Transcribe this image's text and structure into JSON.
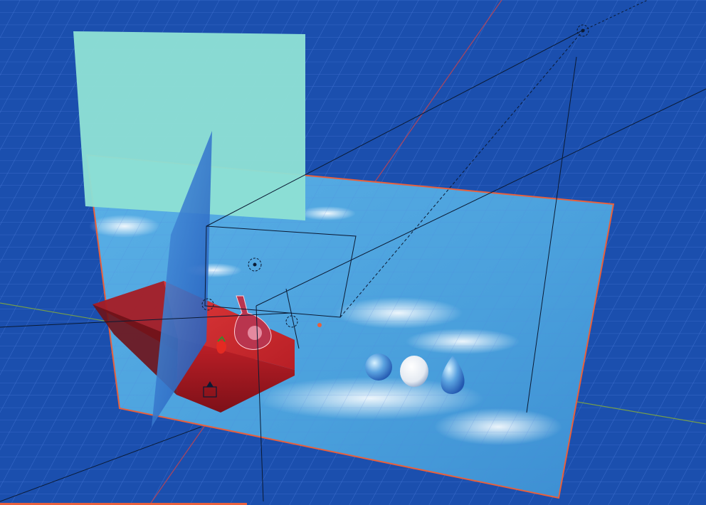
{
  "app": "3D viewport",
  "viewport": {
    "background": "#1b4fae",
    "grid_color": "#4f7fe0",
    "x_axis_color": "#c8434f",
    "y_axis_color": "#7fa640",
    "selection_outline": "#e8603c"
  },
  "objects": [
    {
      "name": "sky-backdrop-plane",
      "icon": "plane-icon",
      "selected": true
    },
    {
      "name": "area-light-plane",
      "icon": "light-area-icon",
      "color": "#8ee0d4"
    },
    {
      "name": "blue-reflector-card",
      "icon": "plane-icon"
    },
    {
      "name": "red-pedestal",
      "icon": "cube-icon",
      "color": "#c82a2a"
    },
    {
      "name": "glass-bottle",
      "icon": "mesh-icon"
    },
    {
      "name": "strawberry",
      "icon": "mesh-icon"
    },
    {
      "name": "glass-sphere",
      "icon": "sphere-icon"
    },
    {
      "name": "white-egg",
      "icon": "sphere-icon"
    },
    {
      "name": "glass-drop",
      "icon": "mesh-icon"
    },
    {
      "name": "camera",
      "icon": "camera-icon"
    },
    {
      "name": "sun-light",
      "icon": "sun-icon"
    },
    {
      "name": "point-light",
      "icon": "light-point-icon"
    }
  ],
  "render_progress": 0.35,
  "progress_color": "#e8603c"
}
